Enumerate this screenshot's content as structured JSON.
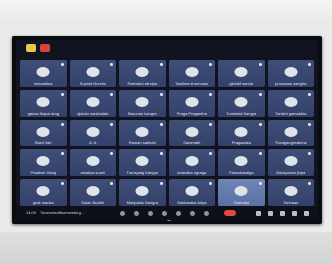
{
  "window": {
    "title": ""
  },
  "meeting": {
    "clock": "14:00",
    "title": "Tonerodeoffsomeinforg...",
    "controls": [
      "mic-icon",
      "camera-icon",
      "share-screen-icon",
      "emoji-icon",
      "more-icon",
      "hand-icon",
      "end-call-icon"
    ],
    "right_controls": [
      "info-icon",
      "people-icon",
      "chat-icon",
      "activities-icon",
      "lock-icon"
    ]
  },
  "participants": [
    "shanadina",
    "Sophia Nunnis",
    "Raimahd slindya",
    "Taatima sharrosan",
    "gildubf sanha",
    "pronnaan sangha",
    "ganaa thapa drag",
    "ajshan sankhaiah",
    "Barunan kangra",
    "Praga Pragantha",
    "Tunshied Kangra",
    "Tonishi gamaktha",
    "Basil Vari",
    "A. A",
    "Raman sabirah",
    "Sammath",
    "Pragaaska",
    "Theagangmaikina",
    "Pradesh Hang",
    "amaliya suani",
    "Transpaig Kangrs",
    "anaralka ngraga",
    "Paraakukalga",
    "Backpacial jhipa",
    "grak rsanka",
    "Salan Budbh",
    "Manjulala Nangra",
    "Sanharaka Adya",
    "Garhaka",
    "Tonhaan"
  ],
  "highlighted_tile": 28
}
